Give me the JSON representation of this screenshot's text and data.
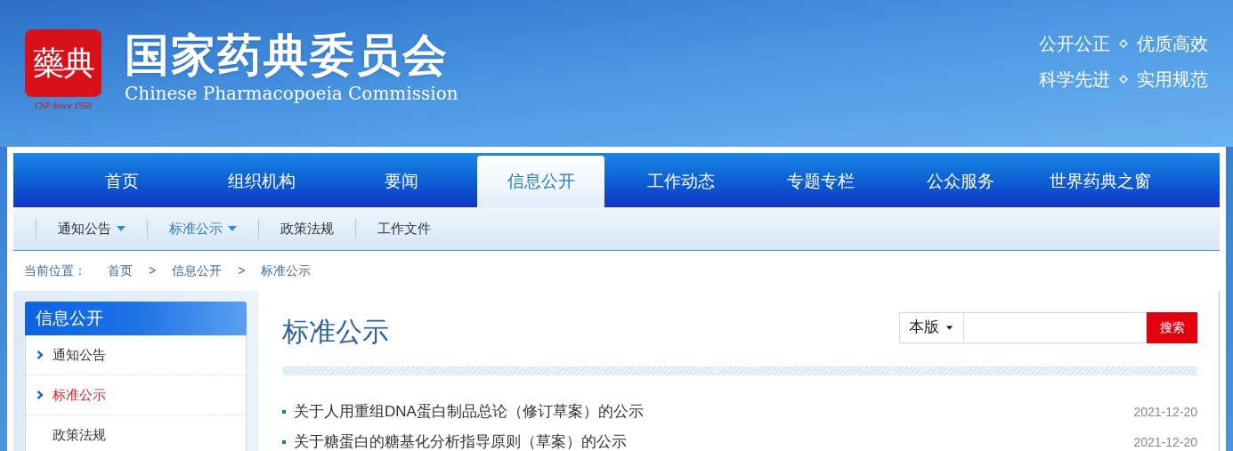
{
  "header": {
    "seal": "藥典",
    "seal_caption": "ChP Since 1950",
    "title": "国家药典委员会",
    "subtitle": "Chinese Pharmacopoeia Commission",
    "mottos": [
      [
        "公开公正",
        "优质高效"
      ],
      [
        "科学先进",
        "实用规范"
      ]
    ]
  },
  "nav": [
    {
      "label": "首页",
      "selected": false
    },
    {
      "label": "组织机构",
      "selected": false
    },
    {
      "label": "要闻",
      "selected": false
    },
    {
      "label": "信息公开",
      "selected": true
    },
    {
      "label": "工作动态",
      "selected": false
    },
    {
      "label": "专题专栏",
      "selected": false
    },
    {
      "label": "公众服务",
      "selected": false
    },
    {
      "label": "世界药典之窗",
      "selected": false
    }
  ],
  "subnav": [
    {
      "label": "通知公告",
      "selected": false,
      "kind": "dropdown"
    },
    {
      "label": "标准公示",
      "selected": true,
      "kind": "dropdown"
    },
    {
      "label": "政策法规",
      "selected": false,
      "kind": "link"
    },
    {
      "label": "工作文件",
      "selected": false,
      "kind": "link"
    }
  ],
  "breadcrumb": {
    "prefix": "当前位置：",
    "items": [
      "首页",
      "信息公开",
      "标准公示"
    ],
    "separator": ">"
  },
  "sidebar": {
    "title": "信息公开",
    "items": [
      {
        "label": "通知公告",
        "selected": false,
        "kind": "arrow"
      },
      {
        "label": "标准公示",
        "selected": true,
        "kind": "arrow"
      },
      {
        "label": "政策法规",
        "selected": false,
        "kind": "plain"
      }
    ]
  },
  "content": {
    "title": "标准公示",
    "search": {
      "scope": "本版",
      "button": "搜索"
    },
    "items": [
      {
        "title": "关于人用重组DNA蛋白制品总论（修订草案）的公示",
        "date": "2021-12-20"
      },
      {
        "title": "关于糖蛋白的糖基化分析指导原则（草案）的公示",
        "date": "2021-12-20"
      }
    ]
  }
}
